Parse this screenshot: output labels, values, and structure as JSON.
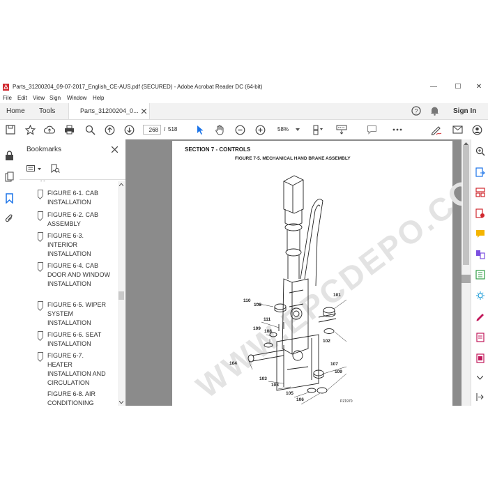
{
  "window": {
    "title": "Parts_31200204_09-07-2017_English_CE-AUS.pdf (SECURED) - Adobe Acrobat Reader DC (64-bit)",
    "minimize": "—",
    "maximize": "☐",
    "close": "✕"
  },
  "menu": [
    "File",
    "Edit",
    "View",
    "Sign",
    "Window",
    "Help"
  ],
  "tabs": {
    "home": "Home",
    "tools": "Tools",
    "doc_tab": "Parts_31200204_0...",
    "sign_in": "Sign In"
  },
  "toolbar": {
    "current_page": "268",
    "page_sep": "/",
    "total_pages": "518",
    "zoom": "58%"
  },
  "bookmarks": {
    "title": "Bookmarks",
    "items": [
      "FIGURE 6-1. CAB INSTALLATION",
      "FIGURE 6-2. CAB ASSEMBLY",
      "FIGURE 6-3. INTERIOR INSTALLATION",
      "FIGURE 6-4. CAB DOOR AND WINDOW INSTALLATION",
      "FIGURE 6-5. WIPER SYSTEM INSTALLATION",
      "FIGURE 6-6. SEAT INSTALLATION",
      "FIGURE 6-7. HEATER INSTALLATION AND CIRCULATION",
      "FIGURE 6-8. AIR CONDITIONING"
    ]
  },
  "document": {
    "section": "SECTION 7 - CONTROLS",
    "figure_title": "FIGURE 7-5. MECHANICAL HAND BRAKE ASSEMBLY",
    "watermark": "WWW.EPCDEPO.COM",
    "drawing_id": "PZ1970",
    "callouts": [
      "110",
      "108",
      "101",
      "111",
      "109",
      "108",
      "102",
      "104",
      "107",
      "109",
      "103",
      "108",
      "105",
      "106"
    ]
  },
  "colors": {
    "accent_red": "#d0282e",
    "icon_blue": "#1a73e8",
    "doc_bg": "#8b8b8b"
  }
}
